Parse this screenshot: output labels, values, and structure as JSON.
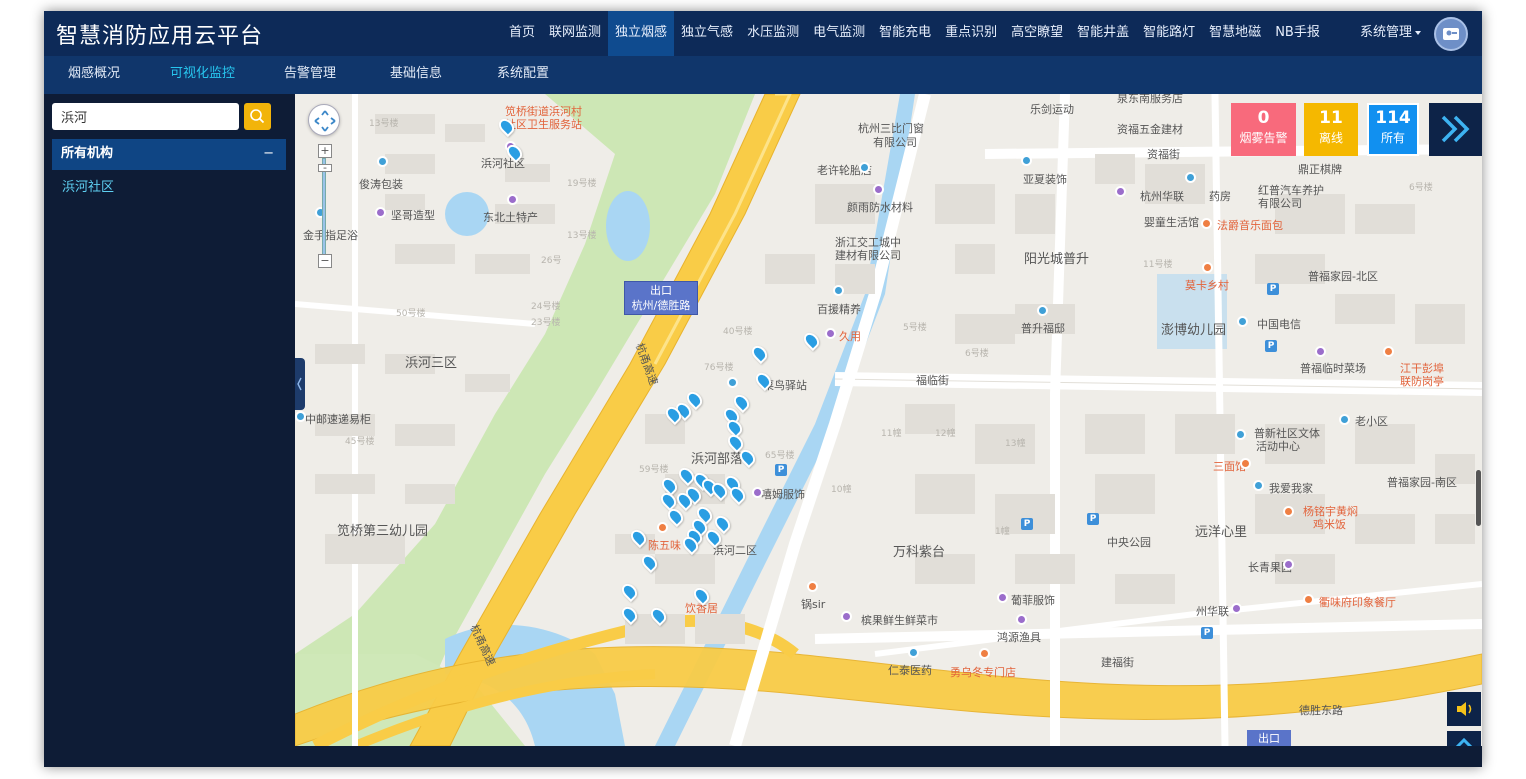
{
  "app": {
    "title": "智慧消防应用云平台"
  },
  "nav": {
    "items": [
      {
        "label": "首页"
      },
      {
        "label": "联网监测"
      },
      {
        "label": "独立烟感",
        "active": true
      },
      {
        "label": "独立气感"
      },
      {
        "label": "水压监测"
      },
      {
        "label": "电气监测"
      },
      {
        "label": "智能充电"
      },
      {
        "label": "重点识别"
      },
      {
        "label": "高空瞭望"
      },
      {
        "label": "智能井盖"
      },
      {
        "label": "智能路灯"
      },
      {
        "label": "智慧地磁"
      },
      {
        "label": "NB手报"
      }
    ],
    "system_menu": "系统管理"
  },
  "subnav": {
    "items": [
      {
        "label": "烟感概况"
      },
      {
        "label": "可视化监控",
        "active": true
      },
      {
        "label": "告警管理"
      },
      {
        "label": "基础信息"
      },
      {
        "label": "系统配置"
      }
    ]
  },
  "sidebar": {
    "search_value": "浜河",
    "org_header": "所有机构",
    "collapse_symbol": "−",
    "org_items": [
      {
        "label": "浜河社区"
      }
    ]
  },
  "counters": {
    "alarm": {
      "value": "0",
      "label": "烟雾告警"
    },
    "offline": {
      "value": "11",
      "label": "离线"
    },
    "all": {
      "value": "114",
      "label": "所有"
    }
  },
  "map": {
    "exit_tag": {
      "line1": "出口",
      "line2": "杭州/德胜路"
    },
    "exit_tag2": "出口",
    "labels": [
      "笕桥街道浜河村",
      "社区卫生服务站",
      "浜河社区",
      "俊涛包装",
      "坚哥造型",
      "东北土特产",
      "金手指足浴",
      "浜河三区",
      "中邮速递易柜",
      "笕桥第三幼儿园",
      "杭州三比门窗",
      "有限公司",
      "老许轮胎店",
      "颜雨防水材料",
      "浙江交工城中",
      "建材有限公司",
      "百援精养",
      "久用",
      "菜鸟驿站",
      "浜河部落",
      "嘻姆服饰",
      "陈五味",
      "浜河二区",
      "饮香居",
      "万科紫台",
      "锅sir",
      "槟果鲜生鲜菜市",
      "葡菲服饰",
      "鸿源渔具",
      "仁泰医药",
      "勇乌冬专门店",
      "建福街",
      "德胜东路",
      "中央公园",
      "远洋心里",
      "长青果园",
      "州华联",
      "衢味府印象餐厅",
      "杨铭宇黄焖",
      "鸡米饭",
      "我爱我家",
      "三面馆",
      "普新社区文体",
      "活动中心",
      "老小区",
      "普福家园-南区",
      "普福临时菜场",
      "江干彭埠",
      "联防岗亭",
      "中国电信",
      "澎博幼儿园",
      "普福家园-北区",
      "莫卡乡村",
      "普升福邸",
      "阳光城普升",
      "法爵音乐面包",
      "婴童生活馆",
      "杭州华联",
      "药房",
      "红普汽车养护",
      "有限公司",
      "鼎正棋牌",
      "亚夏装饰",
      "资福街",
      "资福五金建材",
      "乐剑运动",
      "泉东南服务店",
      "福临街",
      "杭甬高速",
      "杭甬高速"
    ]
  }
}
